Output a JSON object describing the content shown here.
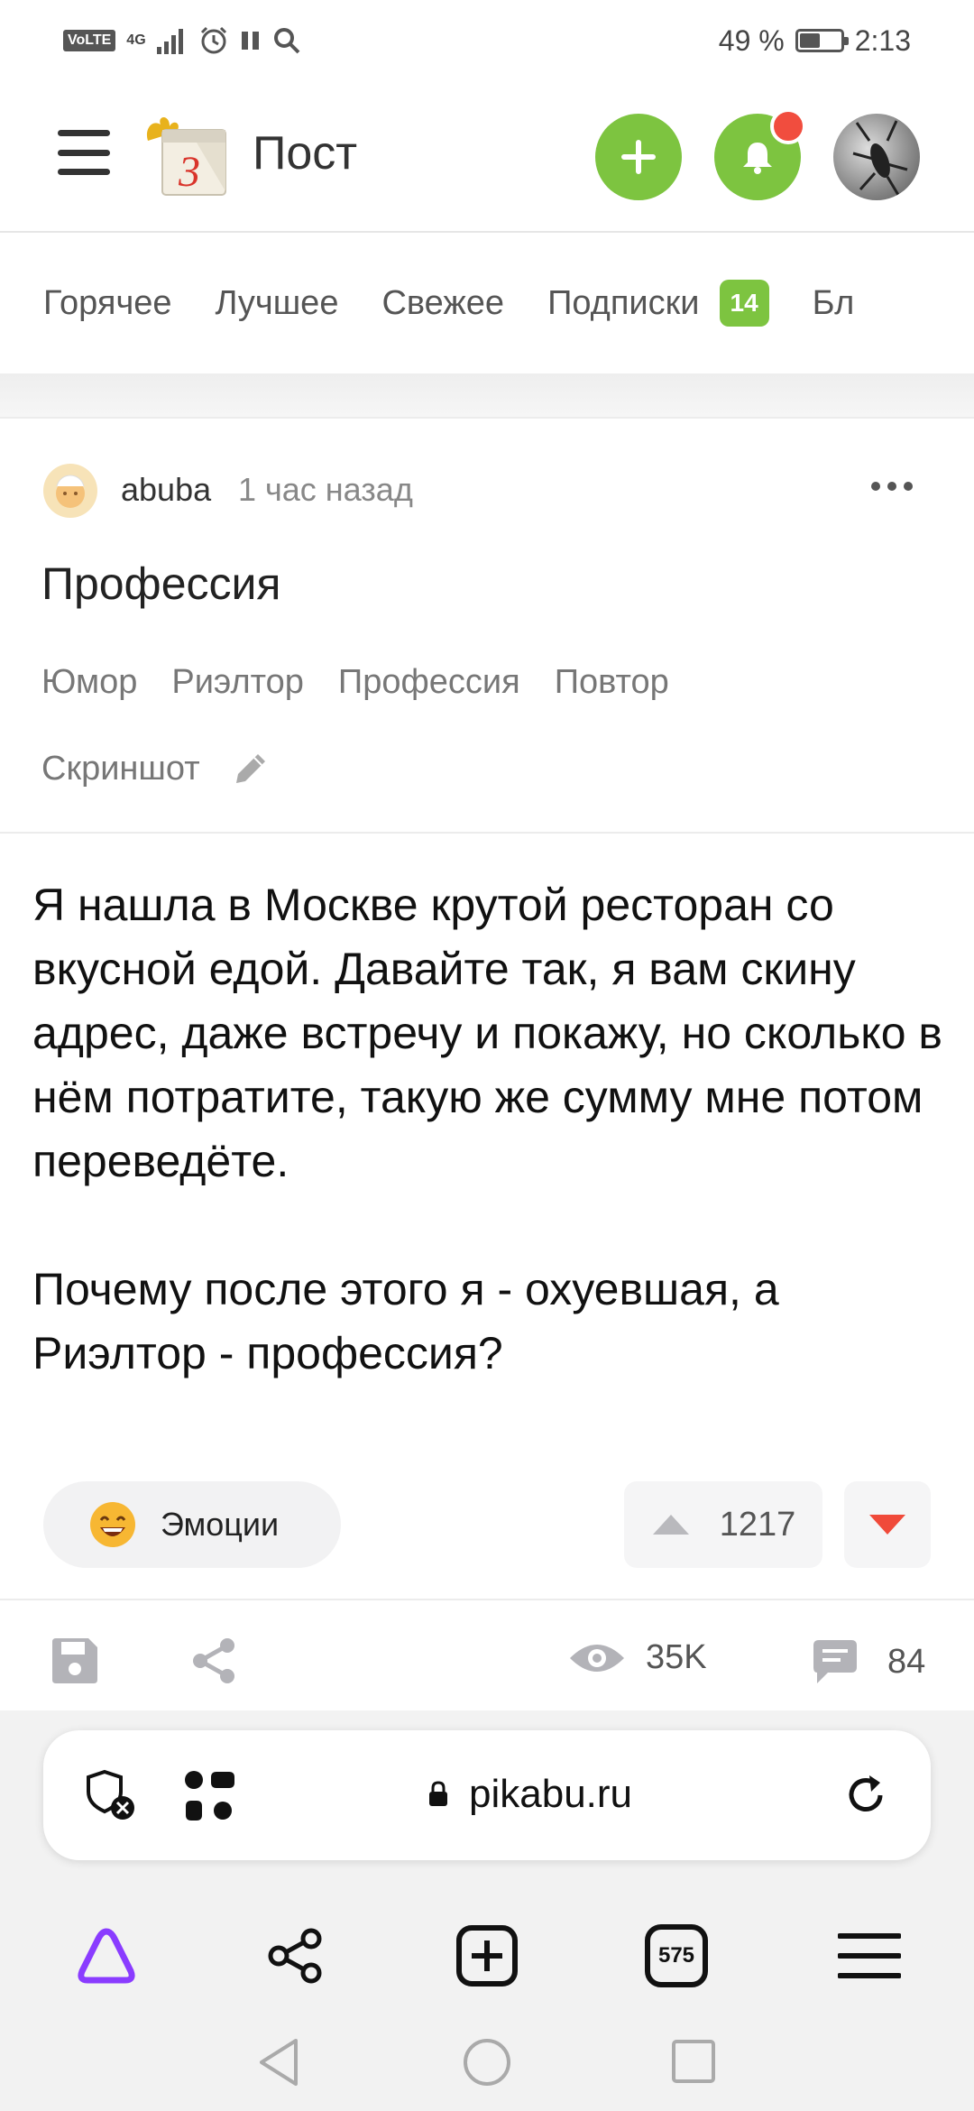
{
  "status_bar": {
    "network": "4G",
    "volte": "VoLTE",
    "battery": "49 %",
    "battery_level": 0.49,
    "time": "2:13"
  },
  "header": {
    "title": "Пост",
    "logo_day": "3"
  },
  "tabs": [
    {
      "label": "Горячее"
    },
    {
      "label": "Лучшее"
    },
    {
      "label": "Свежее"
    },
    {
      "label": "Подписки",
      "badge": "14"
    },
    {
      "label": "Бл"
    }
  ],
  "post": {
    "author": "abuba",
    "time": "1 час назад",
    "title": "Профессия",
    "tags": [
      "Юмор",
      "Риэлтор",
      "Профессия",
      "Повтор",
      "Скриншот"
    ],
    "body": [
      "Я нашла в Москве крутой ресторан со вкусной едой. Давайте так, я вам скину адрес, даже встречу и покажу, но сколько в нём потратите, такую же сумму мне потом переведёте.",
      "Почему после этого я - охуевшая, а Риэлтор - профессия?"
    ],
    "emotions_label": "Эмоции",
    "rating": "1217",
    "views": "35K",
    "comments": "84"
  },
  "browser": {
    "url": "pikabu.ru",
    "tabs_count": "575"
  },
  "colors": {
    "accent_green": "#7dc440",
    "notification_red": "#f14d3e",
    "downvote_red": "#f04a3a"
  }
}
